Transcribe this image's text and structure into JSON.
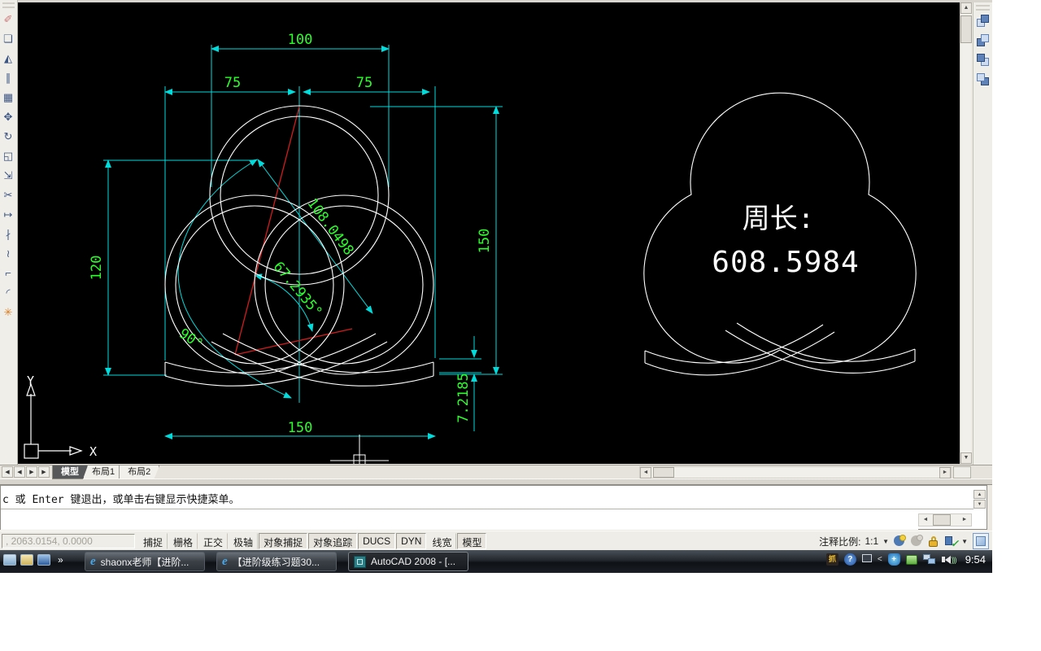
{
  "drawing": {
    "dims": {
      "top_width": "100",
      "left_half": "75",
      "right_half": "75",
      "right_height": "150",
      "left_height": "120",
      "bottom_width": "150",
      "offset_value": "7.2185",
      "angle_90": "90°",
      "diagonal": "108.0498",
      "angle_67": "67.2935°"
    },
    "perimeter_label": "周长:",
    "perimeter_value": "608.5984",
    "ucs": {
      "x_label": "X",
      "y_label": "Y"
    }
  },
  "left_toolbar": {
    "items": [
      {
        "name": "erase",
        "glyph": "✐"
      },
      {
        "name": "copy",
        "glyph": "❏"
      },
      {
        "name": "mirror",
        "glyph": "◭"
      },
      {
        "name": "offset",
        "glyph": "∥"
      },
      {
        "name": "array",
        "glyph": "▦"
      },
      {
        "name": "move",
        "glyph": "✥"
      },
      {
        "name": "rotate",
        "glyph": "↻"
      },
      {
        "name": "scale",
        "glyph": "◱"
      },
      {
        "name": "stretch",
        "glyph": "⇲"
      },
      {
        "name": "trim",
        "glyph": "✂"
      },
      {
        "name": "extend",
        "glyph": "↦"
      },
      {
        "name": "break-at-point",
        "glyph": "∤"
      },
      {
        "name": "break",
        "glyph": "≀"
      },
      {
        "name": "chamfer",
        "glyph": "⌐"
      },
      {
        "name": "fillet",
        "glyph": "◜"
      },
      {
        "name": "explode",
        "glyph": "✳"
      }
    ]
  },
  "tabs": {
    "model": "模型",
    "layout1": "布局1",
    "layout2": "布局2",
    "nav": {
      "first": "◀",
      "prev": "◀",
      "next": "▶",
      "last": "▶"
    }
  },
  "scroll_glyphs": {
    "up": "▲",
    "down": "▼",
    "left": "◄",
    "right": "►"
  },
  "command": {
    "history_line": "c 或 Enter 键退出，或单击右键显示快捷菜单。",
    "input_value": ""
  },
  "statusbar": {
    "coords": ", 2063.0154, 0.0000",
    "buttons": [
      {
        "label": "捕捉"
      },
      {
        "label": "栅格"
      },
      {
        "label": "正交"
      },
      {
        "label": "极轴"
      },
      {
        "label": "对象捕捉"
      },
      {
        "label": "对象追踪"
      },
      {
        "label": "DUCS"
      },
      {
        "label": "DYN"
      },
      {
        "label": "线宽"
      },
      {
        "label": "模型"
      }
    ],
    "annotation_scale_label": "注释比例:",
    "annotation_scale_value": "1:1",
    "dropdown_glyph": "▼"
  },
  "taskbar": {
    "overflow_chevron": "»",
    "ie_glyph": "e",
    "buttons": [
      {
        "label": "shaonx老师【进阶..."
      },
      {
        "label": "【进阶级练习题30..."
      },
      {
        "label": "AutoCAD 2008 - [..."
      }
    ],
    "tray": {
      "help_glyph": "?",
      "chevron": "<",
      "shield_glyph": "+",
      "app_glyph": "抓",
      "clock": "9:54"
    }
  }
}
